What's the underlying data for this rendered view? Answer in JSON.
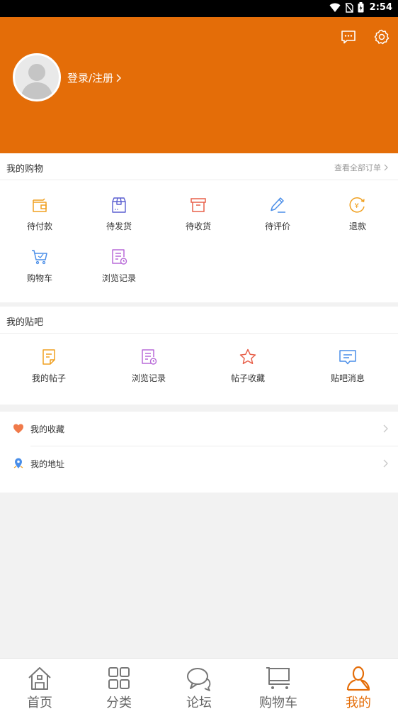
{
  "status_bar": {
    "time": "2:54"
  },
  "header": {
    "login_label": "登录/注册"
  },
  "shopping": {
    "title": "我的购物",
    "view_all": "查看全部订单",
    "items": [
      {
        "label": "待付款",
        "icon": "wallet-icon"
      },
      {
        "label": "待发货",
        "icon": "package-icon"
      },
      {
        "label": "待收货",
        "icon": "box-icon"
      },
      {
        "label": "待评价",
        "icon": "pen-icon"
      },
      {
        "label": "退款",
        "icon": "refund-icon"
      },
      {
        "label": "购物车",
        "icon": "cart-icon"
      },
      {
        "label": "浏览记录",
        "icon": "history-icon"
      }
    ]
  },
  "tieba": {
    "title": "我的贴吧",
    "items": [
      {
        "label": "我的帖子",
        "icon": "post-icon"
      },
      {
        "label": "浏览记录",
        "icon": "history-icon"
      },
      {
        "label": "帖子收藏",
        "icon": "star-icon"
      },
      {
        "label": "贴吧消息",
        "icon": "message-icon"
      }
    ]
  },
  "list": [
    {
      "label": "我的收藏",
      "icon": "heart-icon"
    },
    {
      "label": "我的地址",
      "icon": "location-icon"
    }
  ],
  "tabs": [
    {
      "label": "首页",
      "icon": "home-icon"
    },
    {
      "label": "分类",
      "icon": "grid-icon"
    },
    {
      "label": "论坛",
      "icon": "chat-icon"
    },
    {
      "label": "购物车",
      "icon": "cart-icon"
    },
    {
      "label": "我的",
      "icon": "user-icon",
      "active": true
    }
  ],
  "colors": {
    "accent": "#e46d08",
    "background": "#f2f2f2"
  }
}
